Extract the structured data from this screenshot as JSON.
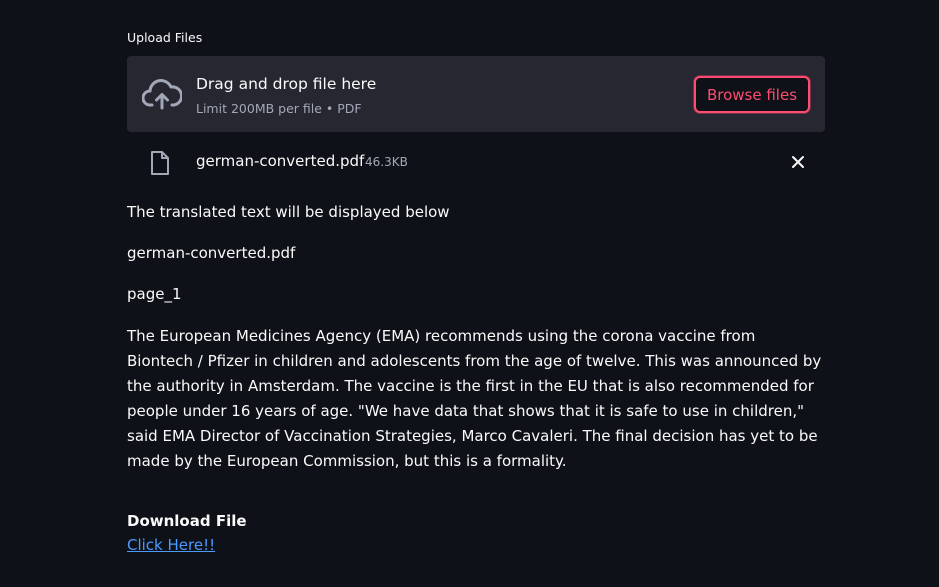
{
  "upload": {
    "label": "Upload Files",
    "dropzone_title": "Drag and drop file here",
    "dropzone_subtitle": "Limit 200MB per file • PDF",
    "browse_label": "Browse files"
  },
  "uploaded_file": {
    "name": "german-converted.pdf",
    "size": "46.3KB"
  },
  "main": {
    "info_text": "The translated text will be displayed below",
    "file_name": "german-converted.pdf",
    "page_label": "page_1",
    "translated_text": "The European Medicines Agency (EMA) recommends using the corona vaccine from Biontech / Pfizer in children and adolescents from the age of twelve. This was announced by the authority in Amsterdam. The vaccine is the first in the EU that is also recommended for people under 16 years of age. \"We have data that shows that it is safe to use in children,\" said EMA Director of Vaccination Strategies, Marco Cavaleri. The final decision has yet to be made by the European Commission, but this is a formality."
  },
  "download": {
    "heading": "Download File",
    "link_label": "Click Here!!"
  },
  "icons": {
    "upload": "cloud-upload-icon",
    "file": "file-icon",
    "remove": "close-icon"
  },
  "colors": {
    "background": "#0e1117",
    "dropzone": "#262730",
    "accent": "#ff4b72",
    "link": "#4c9bff",
    "muted": "#a3a8b8"
  }
}
